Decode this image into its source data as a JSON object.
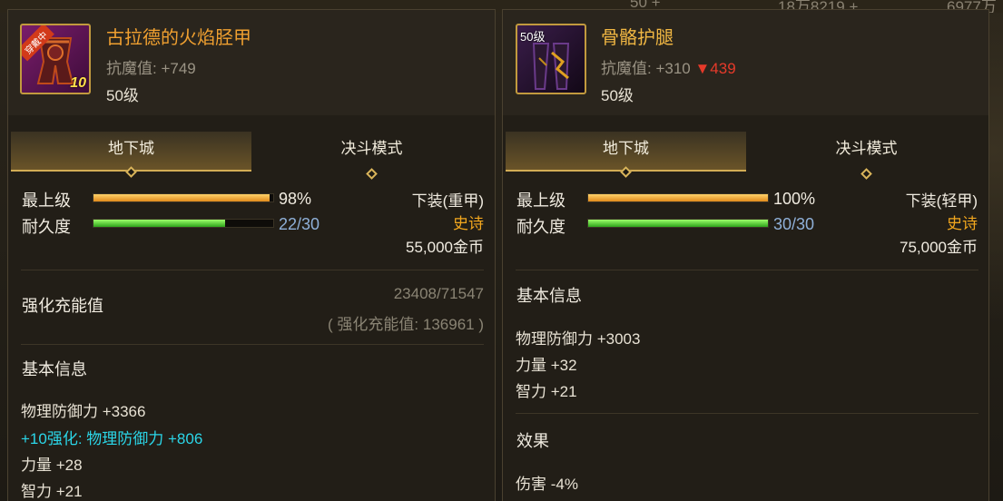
{
  "top_strip": {
    "left_text": "50 +",
    "mid_text": "18万8219 +",
    "right_text": "6977万"
  },
  "left": {
    "name": "古拉德的火焰胫甲",
    "badge": "穿戴中",
    "enhance_level": "10",
    "resist_label": "抗魔值: +749",
    "level": "50级",
    "tabs": [
      "地下城",
      "决斗模式"
    ],
    "grade_label": "最上级",
    "grade_value": "98%",
    "grade_fill": 0.98,
    "durability_label": "耐久度",
    "durability_value": "22/30",
    "durability_fill": 0.733,
    "slot_type": "下装(重甲)",
    "rarity": "史诗",
    "price": "55,000金币",
    "charge_title": "强化充能值",
    "charge_progress": "23408/71547",
    "charge_total": "( 强化充能值: 136961 )",
    "basic_title": "基本信息",
    "stats": [
      {
        "text": "物理防御力 +3366",
        "color": "normal"
      },
      {
        "text": "+10强化: 物理防御力 +806",
        "color": "cyan"
      },
      {
        "text": "力量 +28",
        "color": "normal"
      },
      {
        "text": "智力 +21",
        "color": "normal"
      }
    ]
  },
  "right": {
    "name": "骨骼护腿",
    "icon_level": "50级",
    "resist_label": "抗魔值: +310",
    "resist_diff": "▼439",
    "level": "50级",
    "tabs": [
      "地下城",
      "决斗模式"
    ],
    "grade_label": "最上级",
    "grade_value": "100%",
    "grade_fill": 1.0,
    "durability_label": "耐久度",
    "durability_value": "30/30",
    "durability_fill": 1.0,
    "slot_type": "下装(轻甲)",
    "rarity": "史诗",
    "price": "75,000金币",
    "basic_title": "基本信息",
    "stats": [
      {
        "text": "物理防御力 +3003"
      },
      {
        "text": "力量 +32"
      },
      {
        "text": "智力 +21"
      }
    ],
    "effect_title": "效果",
    "effect_line": "伤害 -4%"
  },
  "colors": {
    "gold_text": "#f0a030",
    "rarity": "#f2a71e",
    "cyan": "#2bd6e8",
    "down_red": "#e63a2a"
  }
}
